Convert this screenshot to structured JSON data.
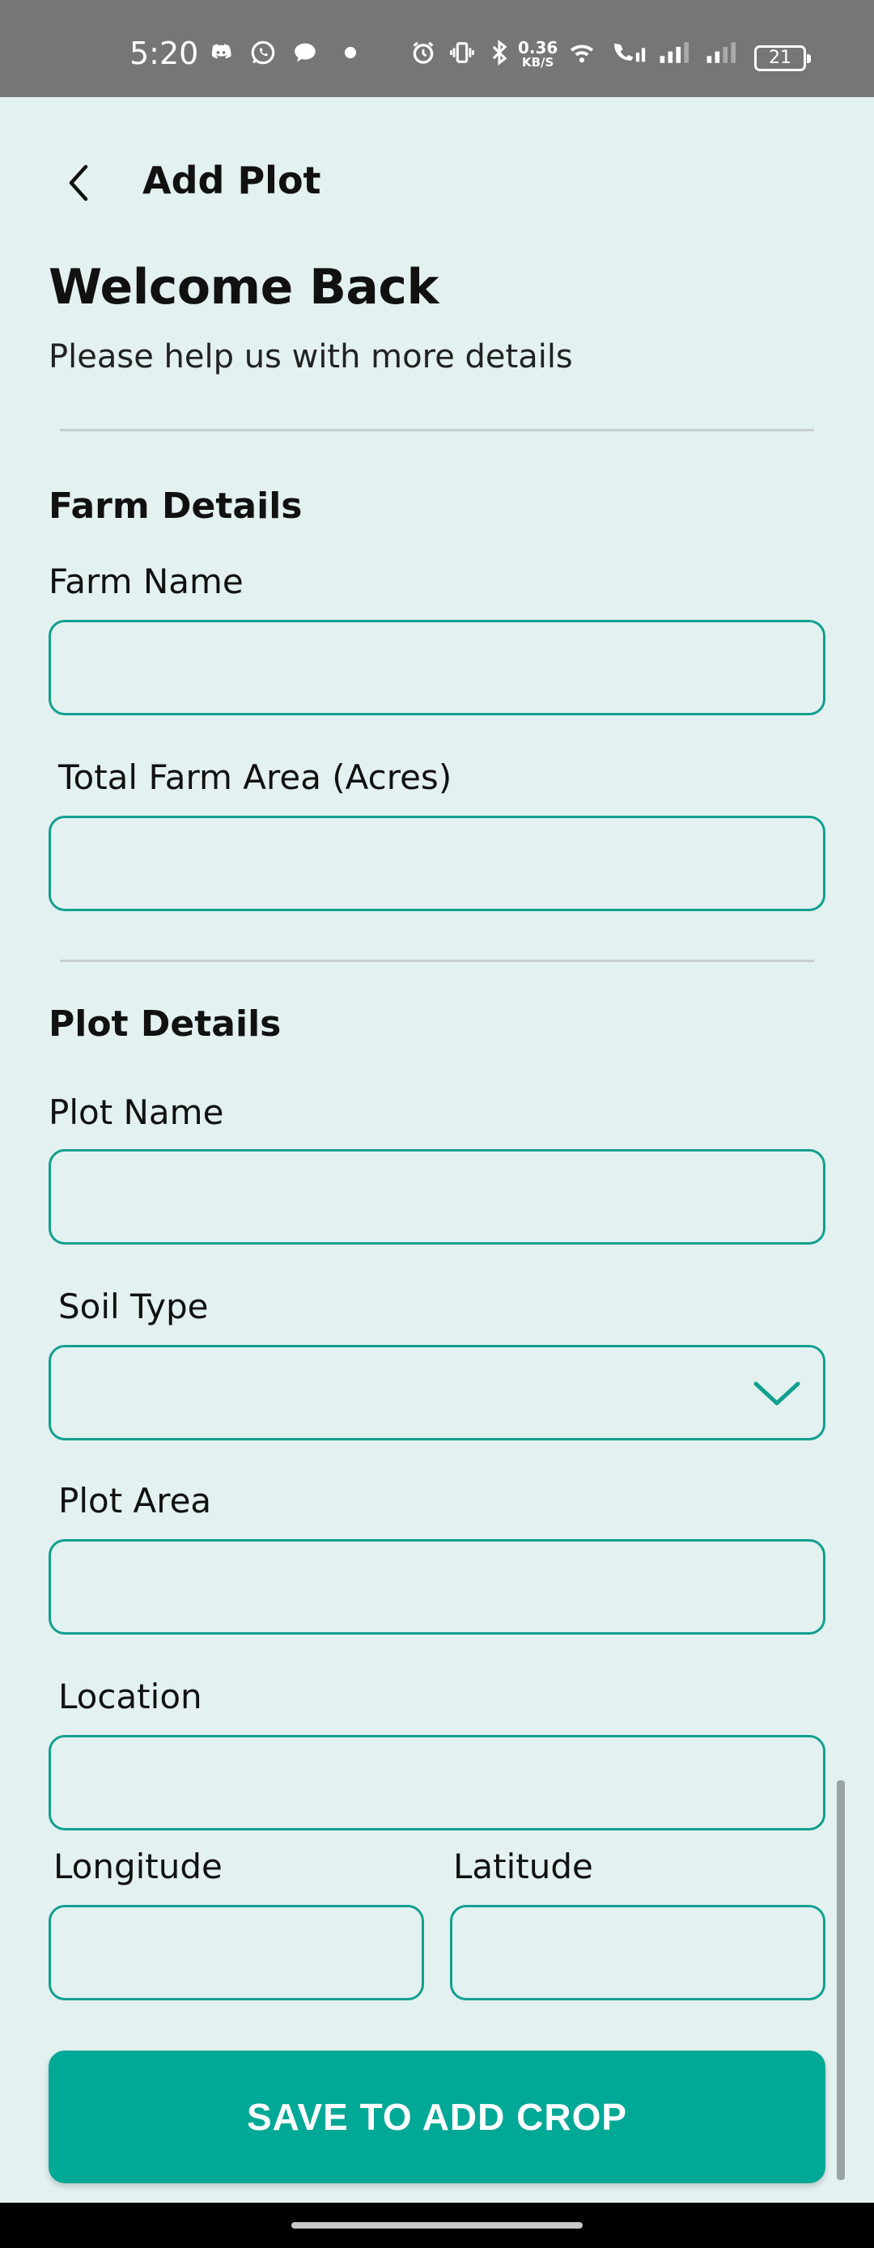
{
  "status_bar": {
    "time": "5:20",
    "net_speed_value": "0.36",
    "net_speed_unit": "KB/S",
    "battery": "21",
    "icons": [
      "discord-icon",
      "whatsapp-icon",
      "chat-icon",
      "dot-icon",
      "alarm-icon",
      "vibrate-icon",
      "bluetooth-icon",
      "wifi-icon",
      "wifi-call-icon",
      "signal-icon",
      "signal-icon"
    ]
  },
  "header": {
    "title": "Add Plot",
    "back_icon": "chevron-left-icon"
  },
  "intro": {
    "heading": "Welcome Back",
    "subtitle": "Please help us with  more details"
  },
  "farm_details": {
    "section_title": "Farm Details",
    "farm_name_label": "Farm Name",
    "farm_name_value": "",
    "total_area_label": "Total Farm  Area (Acres)",
    "total_area_value": ""
  },
  "plot_details": {
    "section_title": "Plot Details",
    "plot_name_label": "Plot Name",
    "plot_name_value": "",
    "soil_type_label": "Soil Type",
    "soil_type_value": "",
    "plot_area_label": "Plot Area",
    "plot_area_value": "",
    "location_label": "Location",
    "location_value": "",
    "longitude_label": "Longitude",
    "longitude_value": "",
    "latitude_label": "Latitude",
    "latitude_value": ""
  },
  "actions": {
    "save_label": "SAVE TO ADD CROP"
  },
  "colors": {
    "background": "#e3f1f0",
    "accent": "#00a896",
    "field_border": "#11a08f",
    "status_bar": "#767676"
  }
}
